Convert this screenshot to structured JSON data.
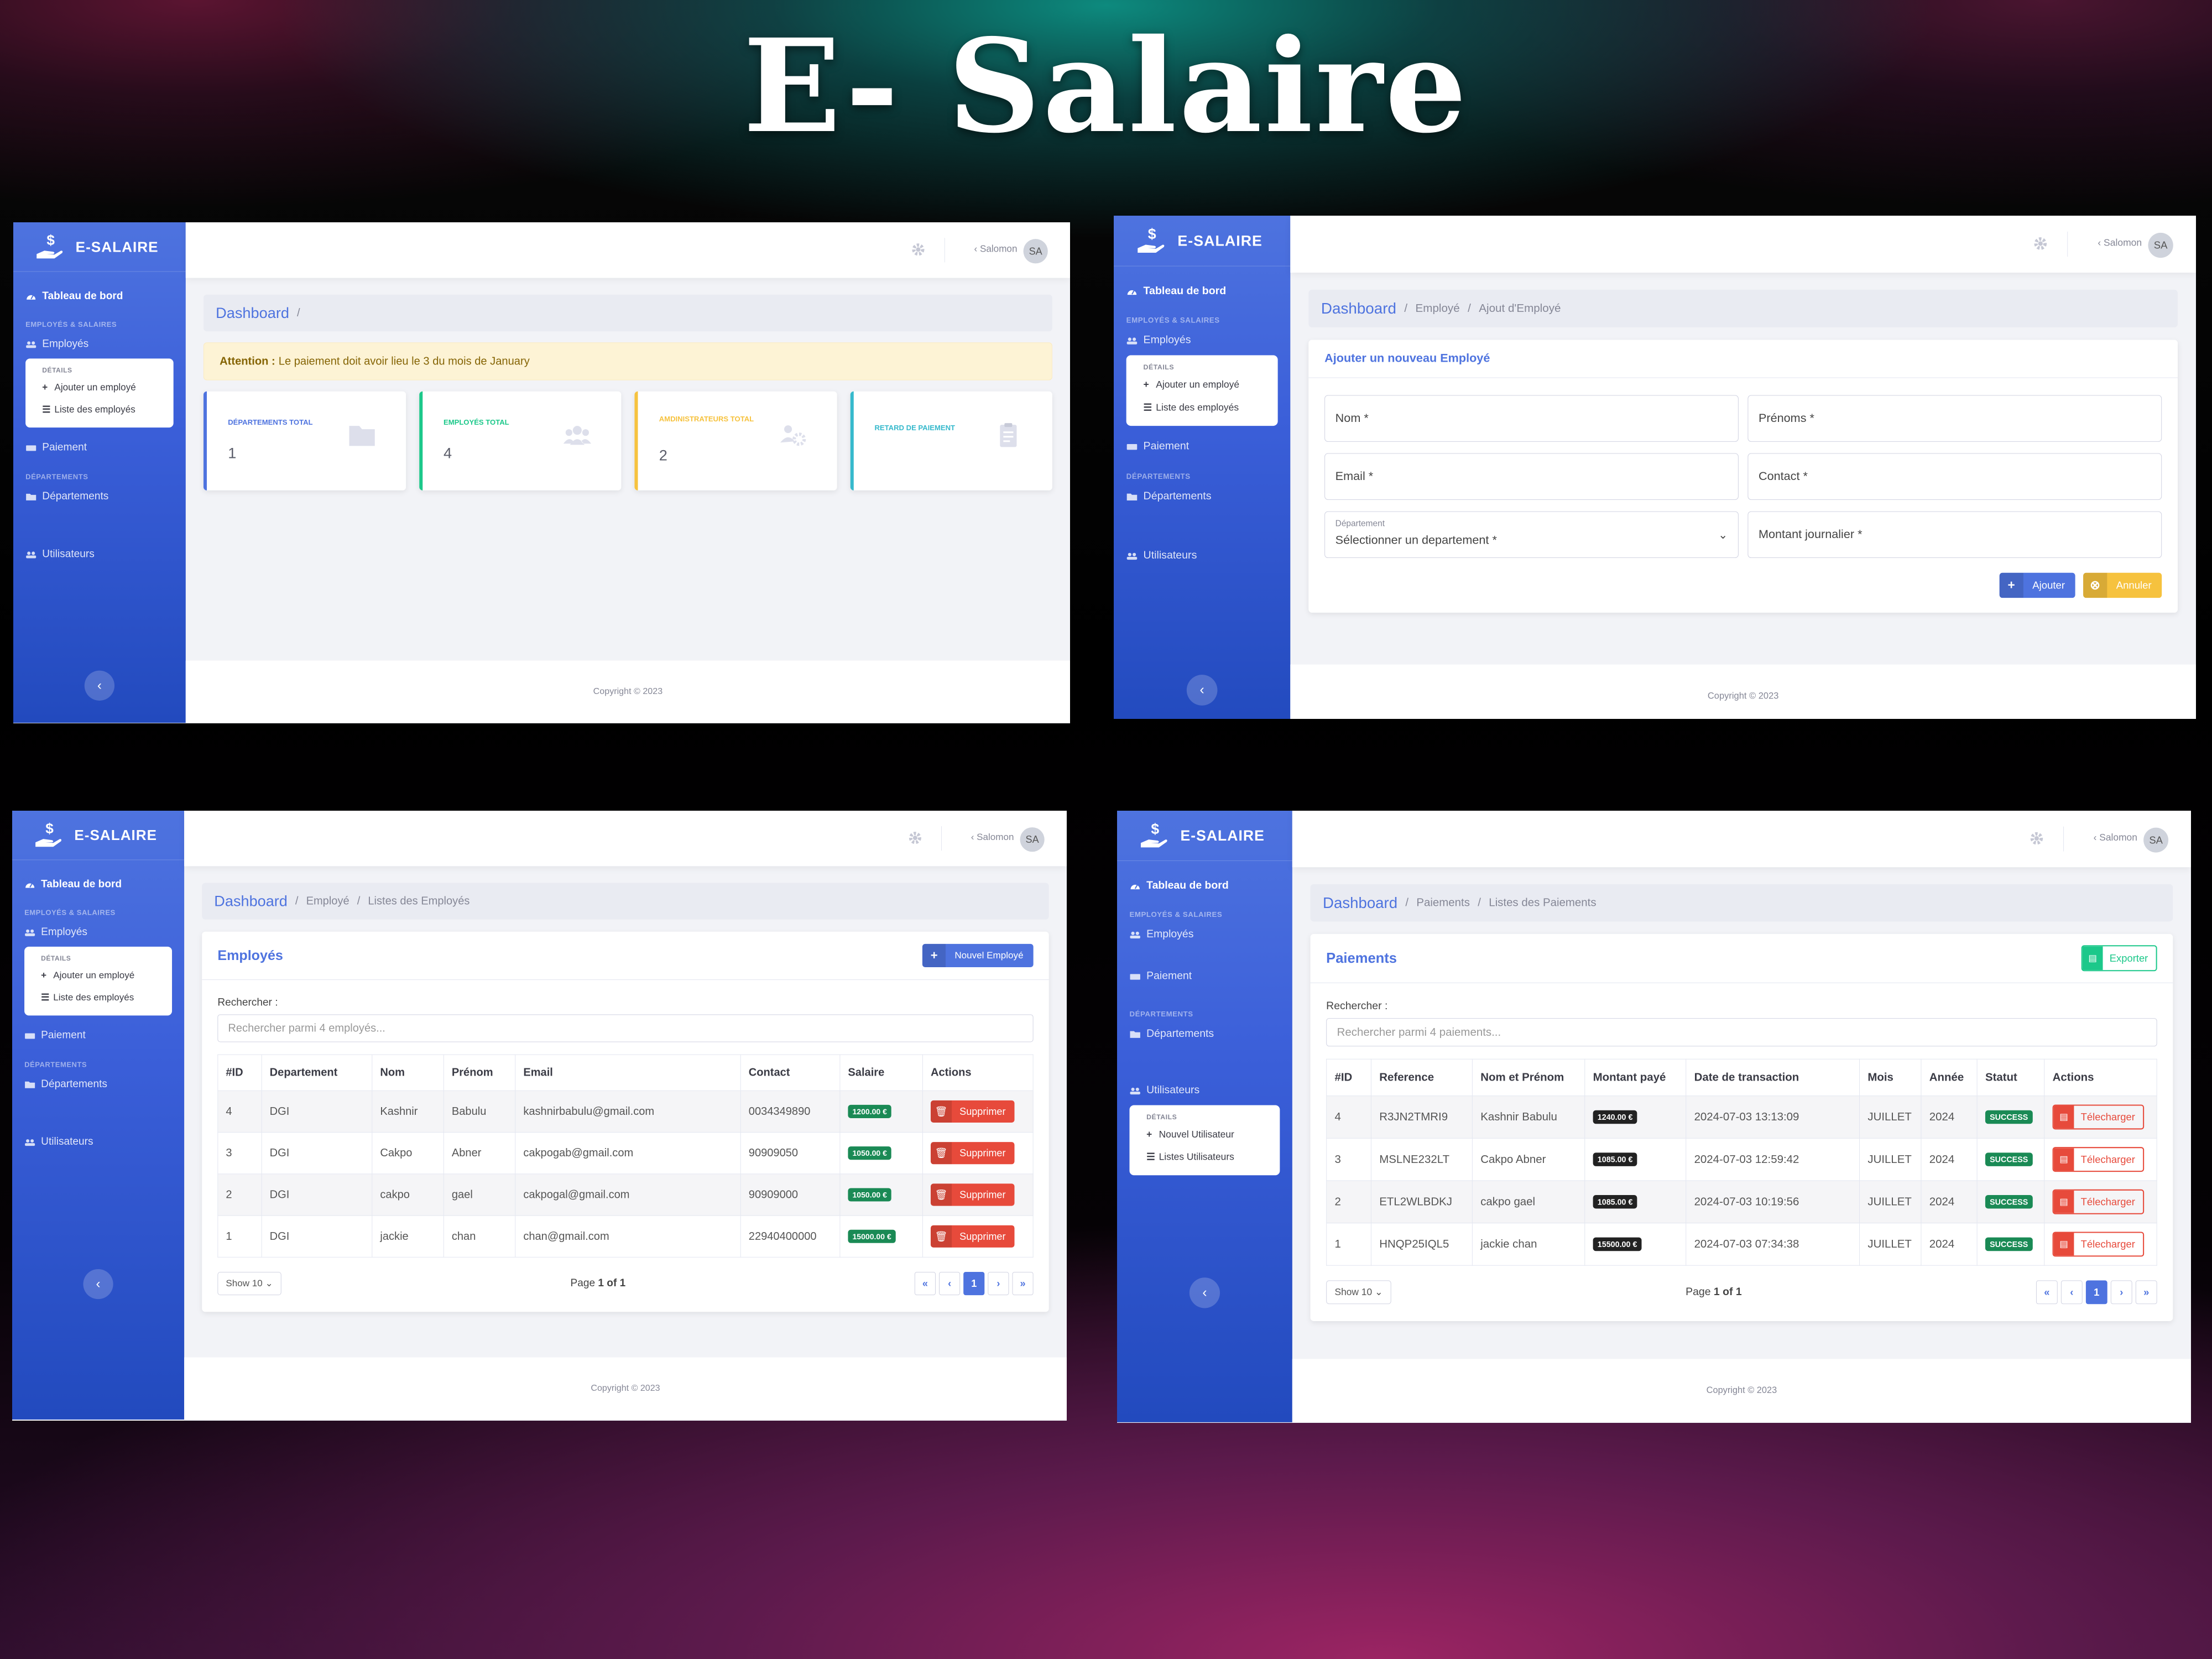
{
  "slide_title": "E- Salaire",
  "colors": {
    "primary": "#4e73df",
    "success": "#1cc88a",
    "warning": "#f6c23e",
    "info": "#36b9cc",
    "danger": "#e74a3b"
  },
  "sidebar": {
    "brand": "E-SALAIRE",
    "dashboard": "Tableau de bord",
    "section_employees": "EMPLOYÉS & SALAIRES",
    "employees": "Employés",
    "details_head": "DÉTAILS",
    "add_employee": "Ajouter un employé",
    "list_employees": "Liste des employés",
    "payment": "Paiement",
    "section_departments": "DÉPARTEMENTS",
    "departments": "Départements",
    "users": "Utilisateurs",
    "new_user": "Nouvel Utilisateur",
    "list_users": "Listes Utilisateurs",
    "collapse_icon": "chevron-left-icon"
  },
  "topbar": {
    "username": "Salomon",
    "avatar": "SA",
    "settings_icon": "gear-icon"
  },
  "footer": "Copyright © 2023",
  "breadcrumb": {
    "home": "Dashboard",
    "sep": "/",
    "employee": "Employé",
    "add_employee": "Ajout d'Employé",
    "list_employees": "Listes des Employés",
    "payments": "Paiements",
    "list_payments": "Listes des Paiements"
  },
  "dashboard": {
    "alert_bold": "Attention :",
    "alert_text": "Le paiement doit avoir lieu le 3 du mois de January",
    "cards": [
      {
        "label": "DÉPARTEMENTS TOTAL",
        "value": "1",
        "color": "#4e73df",
        "icon": "folder-icon"
      },
      {
        "label": "EMPLOYÉS TOTAL",
        "value": "4",
        "color": "#1cc88a",
        "icon": "users-icon"
      },
      {
        "label": "AMDINISTRATEURS TOTAL",
        "value": "2",
        "color": "#f6c23e",
        "icon": "users-cog-icon"
      },
      {
        "label": "RETARD DE PAIEMENT",
        "value": "",
        "color": "#36b9cc",
        "icon": "clipboard-icon"
      }
    ]
  },
  "add_form": {
    "title": "Ajouter un nouveau Employé",
    "nom": "Nom *",
    "prenoms": "Prénoms *",
    "email": "Email *",
    "contact": "Contact *",
    "dept_label": "Département",
    "dept_value": "Sélectionner un departement *",
    "montant": "Montant journalier *",
    "btn_add": "Ajouter",
    "btn_cancel": "Annuler"
  },
  "employees": {
    "title": "Employés",
    "new_btn": "Nouvel Employé",
    "search_label": "Rechercher :",
    "search_placeholder": "Rechercher parmi 4 employés...",
    "columns": [
      "#ID",
      "Departement",
      "Nom",
      "Prénom",
      "Email",
      "Contact",
      "Salaire",
      "Actions"
    ],
    "rows": [
      {
        "id": "4",
        "dept": "DGI",
        "nom": "Kashnir",
        "prenom": "Babulu",
        "email": "kashnirbabulu@gmail.com",
        "contact": "0034349890",
        "salaire": "1200.00 €"
      },
      {
        "id": "3",
        "dept": "DGI",
        "nom": "Cakpo",
        "prenom": "Abner",
        "email": "cakpogab@gmail.com",
        "contact": "90909050",
        "salaire": "1050.00 €"
      },
      {
        "id": "2",
        "dept": "DGI",
        "nom": "cakpo",
        "prenom": "gael",
        "email": "cakpogal@gmail.com",
        "contact": "90909000",
        "salaire": "1050.00 €"
      },
      {
        "id": "1",
        "dept": "DGI",
        "nom": "jackie",
        "prenom": "chan",
        "email": "chan@gmail.com",
        "contact": "22940400000",
        "salaire": "15000.00 €"
      }
    ],
    "delete_label": "Supprimer",
    "show": "Show 10",
    "page_prefix": "Page",
    "page_num": "1 of 1",
    "page_current": "1"
  },
  "payments": {
    "title": "Paiements",
    "export_btn": "Exporter",
    "search_label": "Rechercher :",
    "search_placeholder": "Rechercher parmi 4 paiements...",
    "columns": [
      "#ID",
      "Reference",
      "Nom et Prénom",
      "Montant payé",
      "Date de transaction",
      "Mois",
      "Année",
      "Statut",
      "Actions"
    ],
    "rows": [
      {
        "id": "4",
        "ref": "R3JN2TMRI9",
        "nom": "Kashnir Babulu",
        "montant": "1240.00 €",
        "date": "2024-07-03 13:13:09",
        "mois": "JUILLET",
        "annee": "2024",
        "statut": "SUCCESS"
      },
      {
        "id": "3",
        "ref": "MSLNE232LT",
        "nom": "Cakpo Abner",
        "montant": "1085.00 €",
        "date": "2024-07-03 12:59:42",
        "mois": "JUILLET",
        "annee": "2024",
        "statut": "SUCCESS"
      },
      {
        "id": "2",
        "ref": "ETL2WLBDKJ",
        "nom": "cakpo gael",
        "montant": "1085.00 €",
        "date": "2024-07-03 10:19:56",
        "mois": "JUILLET",
        "annee": "2024",
        "statut": "SUCCESS"
      },
      {
        "id": "1",
        "ref": "HNQP25IQL5",
        "nom": "jackie chan",
        "montant": "15500.00 €",
        "date": "2024-07-03 07:34:38",
        "mois": "JUILLET",
        "annee": "2024",
        "statut": "SUCCESS"
      }
    ],
    "download_label": "Télecharger",
    "show": "Show 10",
    "page_prefix": "Page",
    "page_num": "1 of 1",
    "page_current": "1"
  }
}
